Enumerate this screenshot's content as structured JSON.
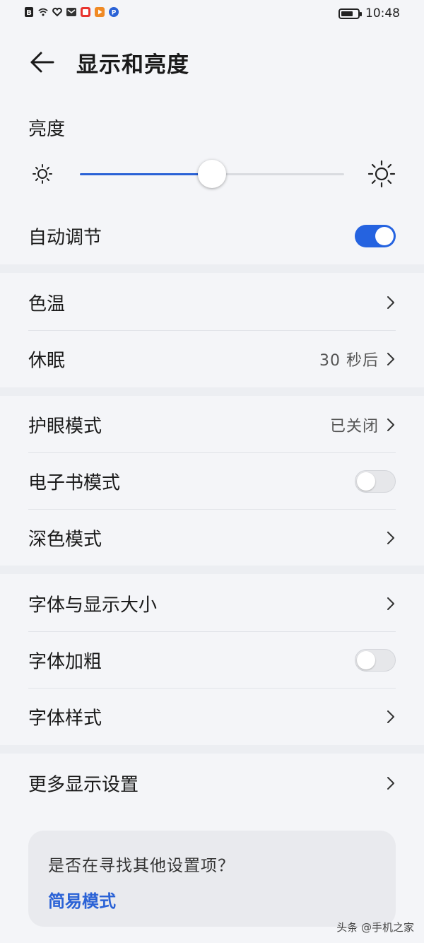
{
  "status_bar": {
    "time": "10:48",
    "battery_level": 0.75,
    "icons": [
      "b-icon",
      "wifi-icon",
      "heart-icon",
      "mail-icon",
      "square-icon",
      "play-icon",
      "blue-app-icon"
    ]
  },
  "header": {
    "title": "显示和亮度",
    "back_icon": "arrow-left-icon"
  },
  "brightness": {
    "label": "亮度",
    "level": 0.5,
    "accent": "#2a62d6"
  },
  "auto_adjust": {
    "label": "自动调节",
    "enabled": true
  },
  "groups": {
    "color_temp": {
      "label": "色温"
    },
    "sleep": {
      "label": "休眠",
      "value": "30 秒后"
    },
    "eye_comfort": {
      "label": "护眼模式",
      "value": "已关闭"
    },
    "ebook": {
      "label": "电子书模式",
      "enabled": false
    },
    "dark_mode": {
      "label": "深色模式"
    },
    "font_size": {
      "label": "字体与显示大小"
    },
    "bold_font": {
      "label": "字体加粗",
      "enabled": false
    },
    "font_style": {
      "label": "字体样式"
    },
    "more": {
      "label": "更多显示设置"
    }
  },
  "card": {
    "question": "是否在寻找其他设置项？",
    "link": "简易模式"
  },
  "watermark": "头条 @手机之家",
  "colors": {
    "toggle_on": "#2563e0",
    "background": "#f4f5f8",
    "link": "#2a62d6"
  }
}
